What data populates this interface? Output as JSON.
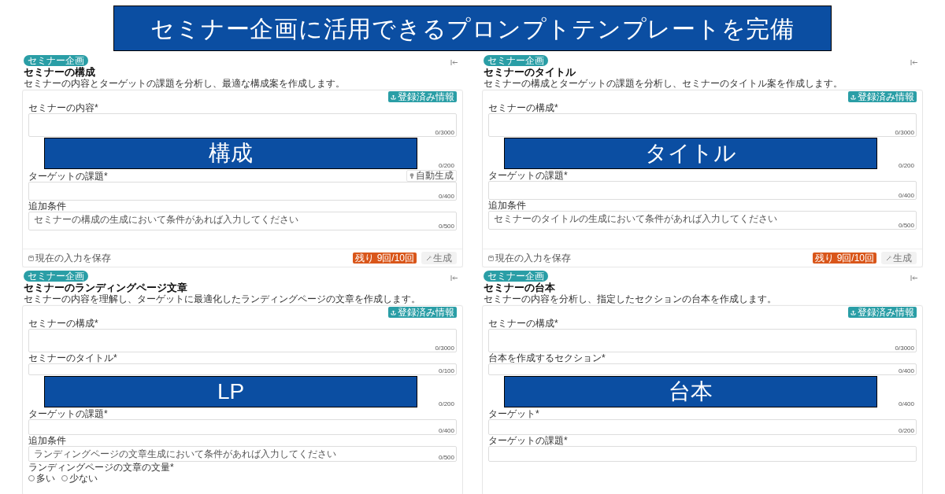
{
  "banner": {
    "title": "セミナー企画に活用できるプロンプトテンプレートを完備"
  },
  "panels": [
    {
      "badge": "セミナー企画",
      "title": "セミナーの構成",
      "description": "セミナーの内容とターゲットの課題を分析し、最適な構成案を作成します。",
      "import_button": "登録済み情報",
      "fields": [
        {
          "kind": "long_text",
          "label": "セミナーの内容*",
          "counter": "0/3000"
        },
        {
          "kind": "overlay",
          "label": "構成",
          "counter": "0/200"
        },
        {
          "kind": "text",
          "label": "ターゲットの課題*",
          "action": "自動生成",
          "counter": "0/400"
        },
        {
          "kind": "text",
          "label": "追加条件",
          "placeholder": "セミナーの構成の生成において条件があれば入力してください",
          "counter": "0/500"
        }
      ],
      "footer": {
        "save": "現在の入力を保存",
        "remaining": "残り 9回/10回",
        "generate": {
          "label": "生成",
          "disabled": true
        }
      }
    },
    {
      "badge": "セミナー企画",
      "title": "セミナーのタイトル",
      "description": "セミナーの構成とターゲットの課題を分析し、セミナーのタイトル案を作成します。",
      "import_button": "登録済み情報",
      "fields": [
        {
          "kind": "long_text",
          "label": "セミナーの構成*",
          "counter": "0/3000"
        },
        {
          "kind": "overlay",
          "label": "タイトル",
          "counter": "0/200"
        },
        {
          "kind": "text",
          "label": "ターゲットの課題*",
          "counter": "0/400"
        },
        {
          "kind": "text",
          "label": "追加条件",
          "placeholder": "セミナーのタイトルの生成において条件があれば入力してください",
          "counter": "0/500"
        }
      ],
      "footer": {
        "save": "現在の入力を保存",
        "remaining": "残り 9回/10回",
        "generate": {
          "label": "生成",
          "disabled": true
        }
      }
    },
    {
      "badge": "セミナー企画",
      "title": "セミナーのランディングページ文章",
      "description": "セミナーの内容を理解し、ターゲットに最適化したランディングページの文章を作成します。",
      "import_button": "登録済み情報",
      "fields": [
        {
          "kind": "long_text",
          "label": "セミナーの構成*",
          "counter": "0/3000"
        },
        {
          "kind": "line",
          "label": "セミナーのタイトル*",
          "counter": "0/100"
        },
        {
          "kind": "overlay",
          "label": "LP",
          "counter": "0/200"
        },
        {
          "kind": "short_text",
          "label": "ターゲットの課題*",
          "counter": "0/400"
        },
        {
          "kind": "short_text",
          "label": "追加条件",
          "placeholder": "ランディングページの文章生成において条件があれば入力してください",
          "counter": "0/500"
        },
        {
          "kind": "radio",
          "label": "ランディングページの文章の文量*",
          "options": [
            {
              "label": "多い",
              "selected": false
            },
            {
              "label": "少ない",
              "selected": false
            }
          ]
        }
      ]
    },
    {
      "badge": "セミナー企画",
      "title": "セミナーの台本",
      "description": "セミナーの内容を分析し、指定したセクションの台本を作成します。",
      "import_button": "登録済み情報",
      "fields": [
        {
          "kind": "long_text",
          "label": "セミナーの構成*",
          "counter": "0/3000"
        },
        {
          "kind": "line",
          "label": "台本を作成するセクション*",
          "counter": "0/400"
        },
        {
          "kind": "overlay",
          "label": "台本",
          "counter": "0/400"
        },
        {
          "kind": "short_text",
          "label": "ターゲット*",
          "counter": "0/200"
        },
        {
          "kind": "short_text",
          "label": "ターゲットの課題*"
        }
      ]
    }
  ]
}
